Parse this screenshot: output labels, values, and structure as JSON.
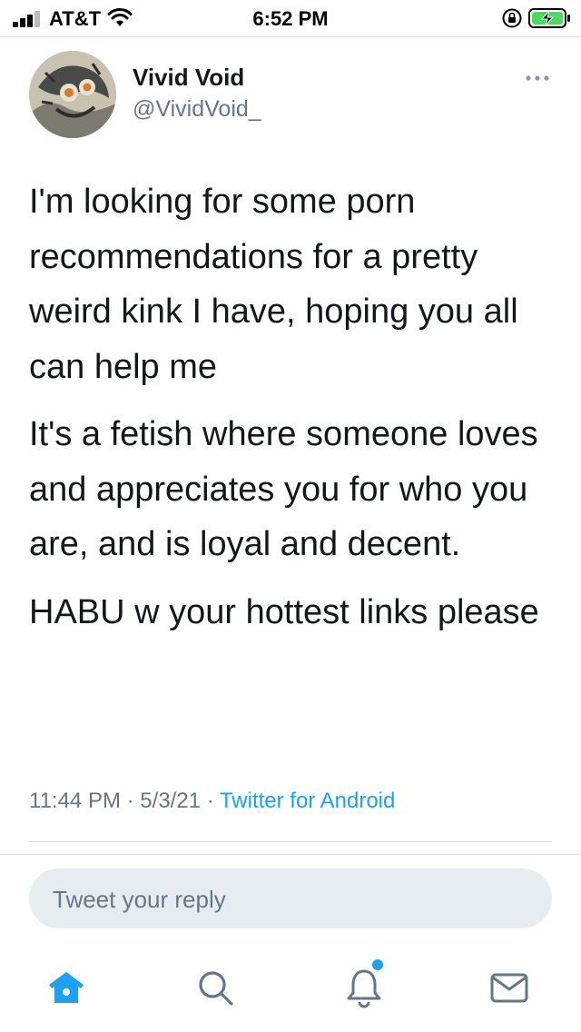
{
  "status_bar": {
    "carrier": "AT&T",
    "time": "6:52 PM"
  },
  "tweet": {
    "display_name": "Vivid Void",
    "handle": "@VividVoid_",
    "paragraphs": [
      "I'm looking for some porn recommendations for a pretty weird kink I have, hoping you all can help me",
      "It's a fetish where someone loves and appreciates you for who you are, and is loyal and decent.",
      "HABU w your hottest links please"
    ],
    "time": "11:44 PM",
    "date": "5/3/21",
    "source": "Twitter for Android",
    "separator": "·"
  },
  "reply": {
    "placeholder": "Tweet your reply"
  },
  "nav": {
    "items": [
      "home-icon",
      "search-icon",
      "notifications-icon",
      "messages-icon"
    ],
    "active": "home-icon"
  },
  "colors": {
    "accent": "#1da1f2",
    "secondary_text": "#657786",
    "reply_bg": "#e6ecf0"
  }
}
